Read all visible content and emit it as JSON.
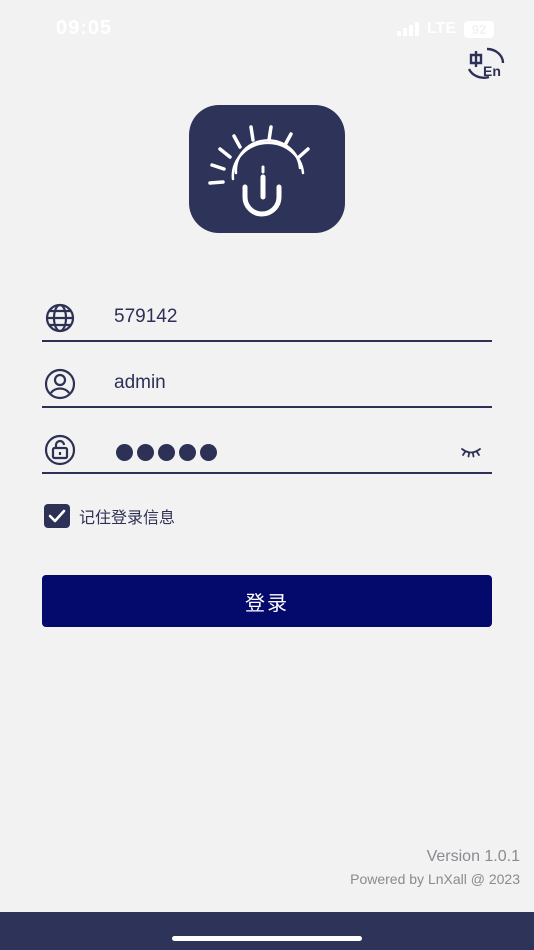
{
  "status_bar": {
    "time": "09:05",
    "network": "LTE",
    "battery": "92"
  },
  "language_toggle": {
    "icon": "language-zh-en-icon"
  },
  "logo": {
    "icon": "app-logo-u-sunrise"
  },
  "form": {
    "account_value": "579142",
    "username_value": "admin",
    "password_masked_length": 5,
    "account_icon": "globe-icon",
    "username_icon": "user-circle-icon",
    "password_icon": "lock-icon",
    "visibility_icon": "eye-closed-icon"
  },
  "remember": {
    "checked": true,
    "label": "记住登录信息"
  },
  "login_button": {
    "label": "登录"
  },
  "footer": {
    "version": "Version 1.0.1",
    "powered_by": "Powered by LnXall @ 2023"
  },
  "colors": {
    "background": "#f2f2f3",
    "primary_dark": "#2e3156",
    "button": "#040a6b",
    "bottom_bar": "#2d3359",
    "muted_text": "#8a8a90"
  }
}
